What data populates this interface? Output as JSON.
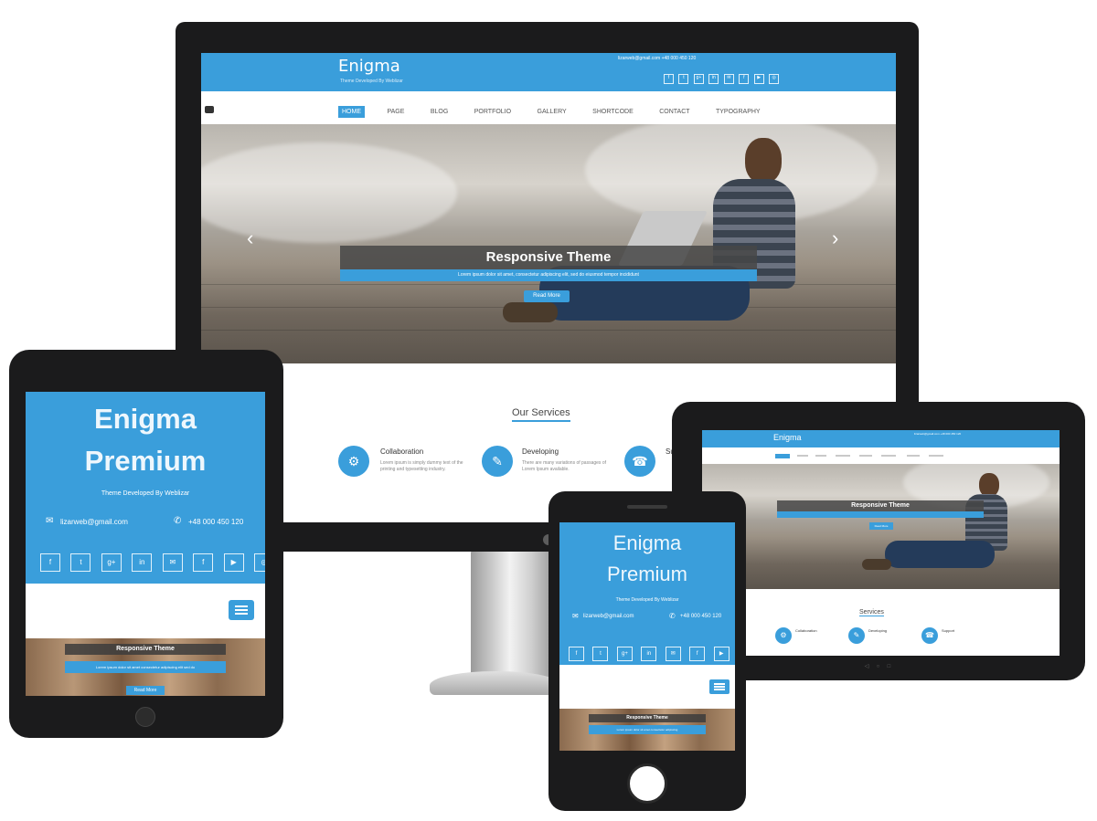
{
  "colors": {
    "accent": "#3a9edb",
    "bezel": "#1b1b1c",
    "white": "#ffffff"
  },
  "desktop": {
    "logo": "Enigma",
    "tagline": "Theme Developed By Weblizar",
    "contact": "lizarweb@gmail.com  +48 000 450 120",
    "nav": [
      "HOME",
      "PAGE",
      "BLOG",
      "PORTFOLIO",
      "GALLERY",
      "SHORTCODE",
      "CONTACT",
      "TYPOGRAPHY"
    ],
    "slider_title": "Responsive Theme",
    "slider_caption": "Lorem ipsum dolor sit amet, consectetur adipiscing elit, sed do eiusmod tempor incididunt",
    "slider_button": "Read More",
    "prev_arrow": "‹",
    "next_arrow": "›",
    "services_heading": "Our Services",
    "services": [
      {
        "title": "Collaboration",
        "text": "Lorem ipsum is simply dummy text of the printing and typesetting industry."
      },
      {
        "title": "Developing",
        "text": "There are many variations of passages of Lorem Ipsum available."
      },
      {
        "title": "Support",
        "text": ""
      }
    ]
  },
  "tablet_portrait": {
    "title_line1": "Enigma",
    "title_line2": "Premium",
    "tagline": "Theme Developed By Weblizar",
    "email": "lizarweb@gmail.com",
    "phone": "+48 000 450 120",
    "slider_title": "Responsive Theme",
    "slider_caption": "Lorem ipsum dolor sit amet consectetur adipiscing elit sed do",
    "slider_button": "Read More"
  },
  "phone": {
    "title_line1": "Enigma",
    "title_line2": "Premium",
    "tagline": "Theme Developed By Weblizar",
    "email": "lizarweb@gmail.com",
    "phone": "+48 000 450 120",
    "slider_title": "Responsive Theme",
    "slider_caption": "Lorem ipsum dolor sit amet consectetur adipiscing"
  },
  "tablet_landscape": {
    "logo": "Enigma",
    "contact": "lizarweb@gmail.com +48 000 450 120",
    "slider_title": "Responsive Theme",
    "slider_button": "Read More",
    "services_heading": "Services",
    "services": [
      "Collaboration",
      "Developing",
      "Support"
    ]
  },
  "social_icons": [
    "f",
    "t",
    "g+",
    "in",
    "✉",
    "f",
    "▶",
    "◎"
  ]
}
